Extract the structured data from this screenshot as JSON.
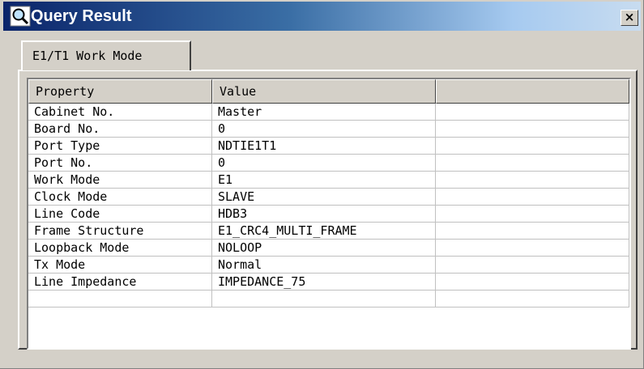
{
  "window": {
    "title": "Query Result",
    "close_label": "×",
    "title_icon": "search-magnifier-icon"
  },
  "tabs": [
    {
      "label": "E1/T1 Work Mode",
      "selected": true
    }
  ],
  "table": {
    "columns": [
      "Property",
      "Value",
      ""
    ],
    "rows": [
      {
        "property": "Cabinet No.",
        "value": "Master"
      },
      {
        "property": "Board No.",
        "value": "0"
      },
      {
        "property": "Port Type",
        "value": "NDTIE1T1"
      },
      {
        "property": "Port No.",
        "value": "0"
      },
      {
        "property": "Work Mode",
        "value": "E1"
      },
      {
        "property": "Clock Mode",
        "value": "SLAVE"
      },
      {
        "property": "Line Code",
        "value": "HDB3"
      },
      {
        "property": "Frame Structure",
        "value": "E1_CRC4_MULTI_FRAME"
      },
      {
        "property": "Loopback Mode",
        "value": "NOLOOP"
      },
      {
        "property": "Tx Mode",
        "value": "Normal"
      },
      {
        "property": "Line Impedance",
        "value": "IMPEDANCE_75"
      },
      {
        "property": "",
        "value": ""
      }
    ]
  },
  "colors": {
    "title_start": "#0a246a",
    "title_end": "#a6caf0",
    "face": "#d4d0c8"
  }
}
